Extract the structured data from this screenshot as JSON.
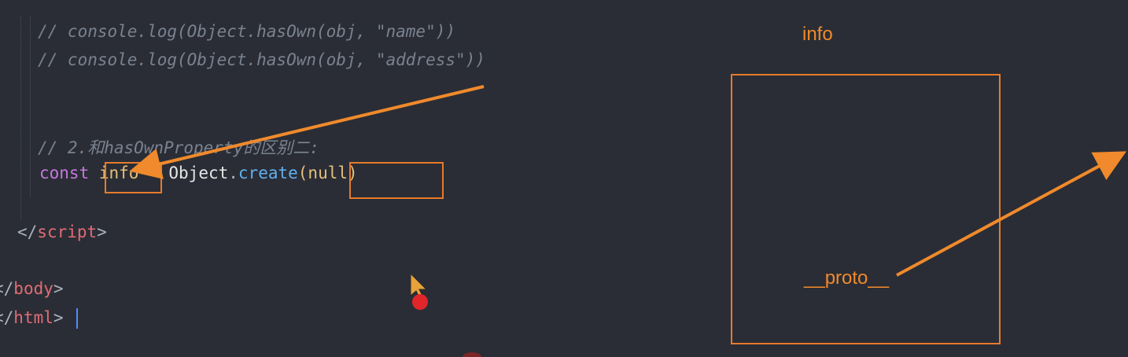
{
  "editor": {
    "lines": {
      "comment_hasown_name": "// console.log(Object.hasOwn(obj, \"name\"))",
      "comment_hasown_address": "// console.log(Object.hasOwn(obj, \"address\"))",
      "comment_difference": "// 2.和hasOwnProperty的区别二:",
      "const_kw": "const",
      "info_var": "info",
      "equals": " = ",
      "object_name": "Object",
      "dot": ".",
      "create_fn": "create",
      "open_paren": "(",
      "null_kw": "null",
      "close_paren": ")",
      "script_close_open": "</",
      "script_tag": "script",
      "script_close_end": ">",
      "body_close_open": "</",
      "body_tag": "body",
      "body_close_end": ">",
      "html_close_open": "</",
      "html_tag": "html",
      "html_close_end": ">"
    }
  },
  "annotations": {
    "info_label": "info",
    "proto_label": "__proto__",
    "color": "#e87a2b"
  },
  "colors": {
    "background": "#2a2d35",
    "keyword": "#c678dd",
    "variable": "#e5c07b",
    "function": "#61afef",
    "tag": "#e06c75",
    "comment": "#7a8290"
  }
}
